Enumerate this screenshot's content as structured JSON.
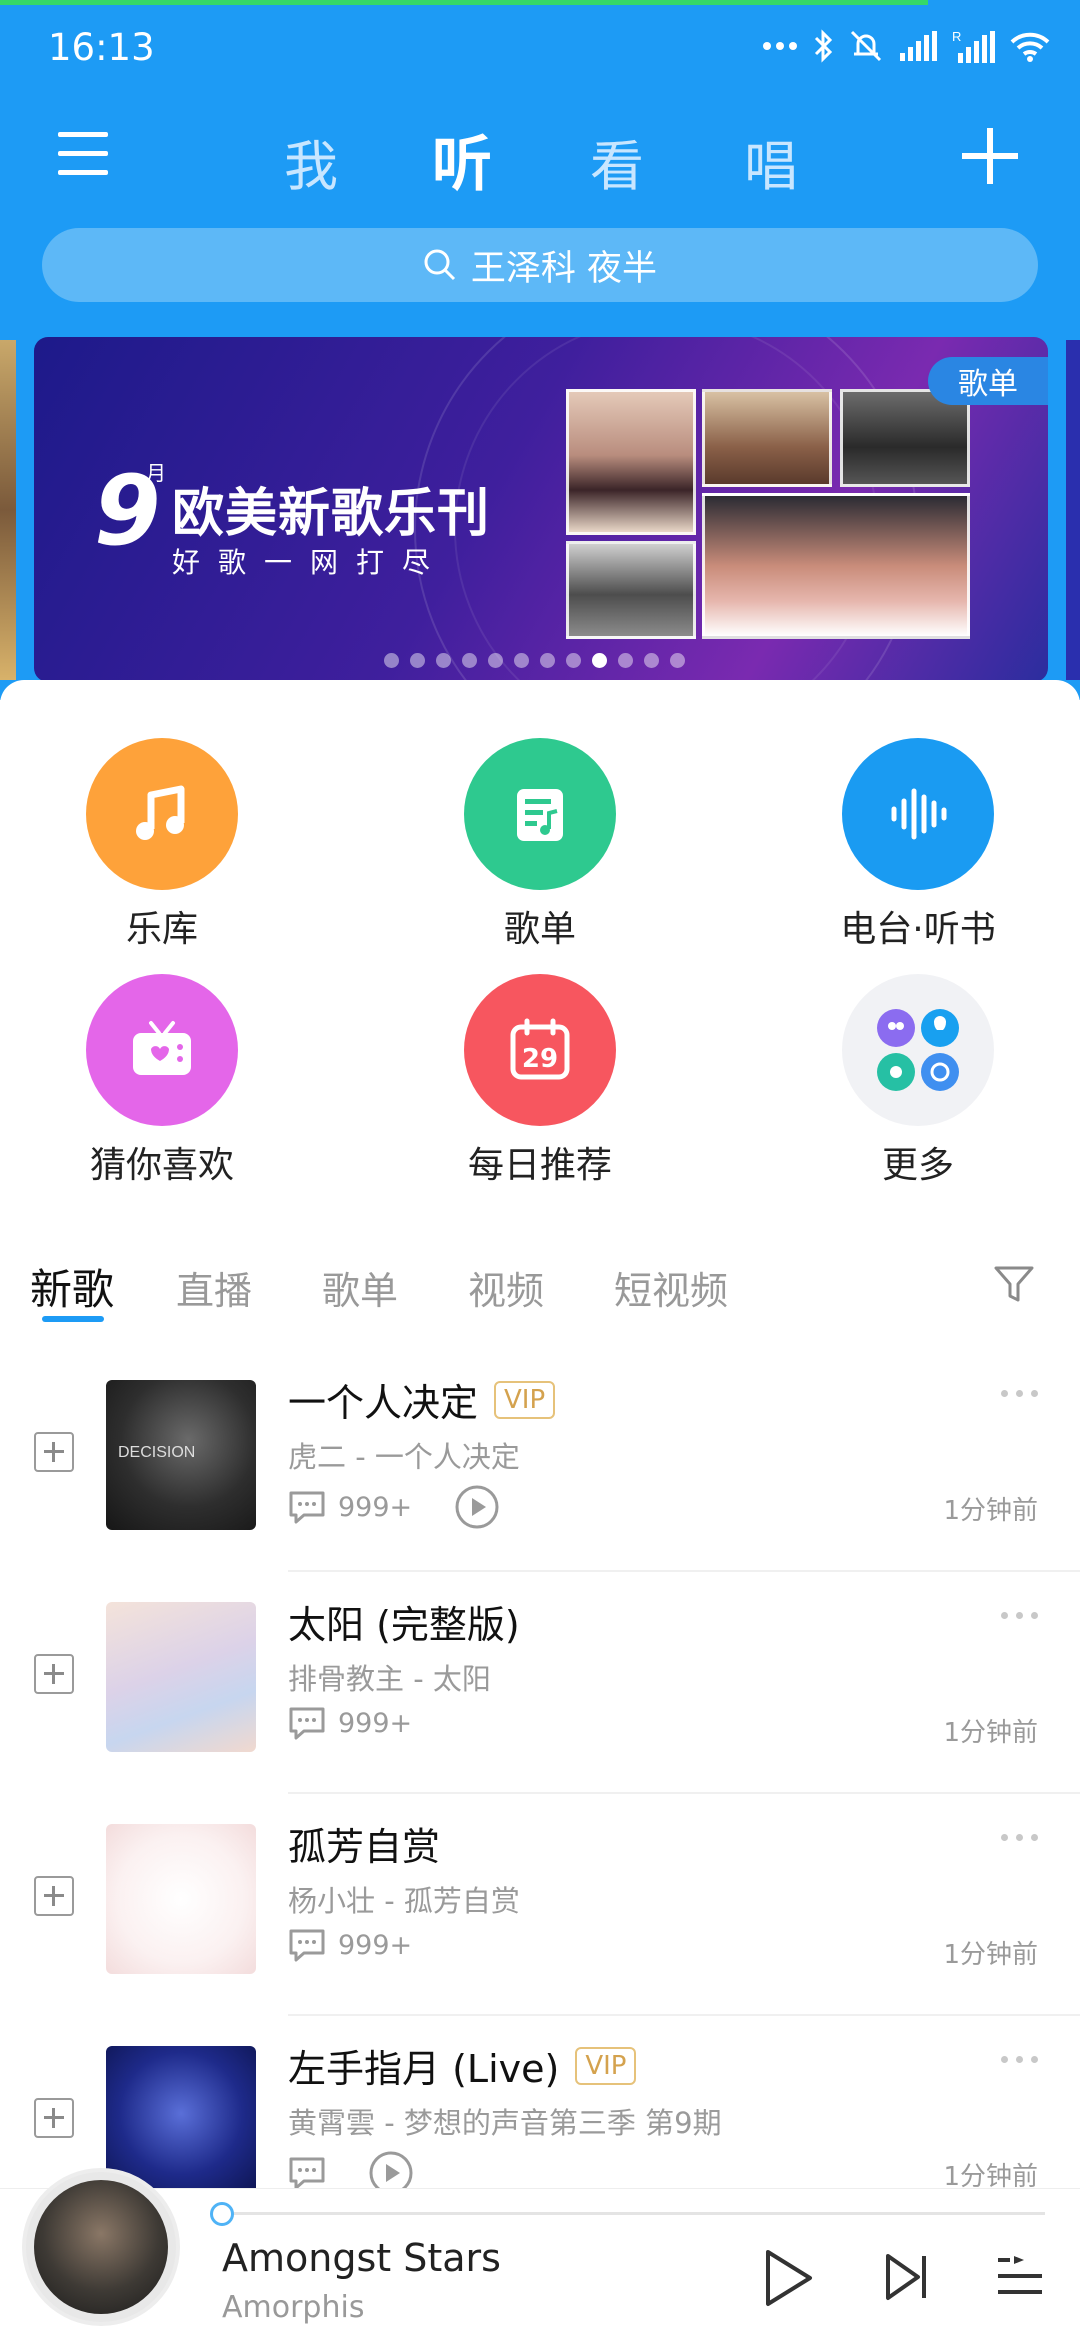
{
  "status_bar": {
    "time": "16:13"
  },
  "header": {
    "tabs": [
      {
        "label": "我",
        "active": false
      },
      {
        "label": "听",
        "active": true
      },
      {
        "label": "看",
        "active": false
      },
      {
        "label": "唱",
        "active": false
      }
    ]
  },
  "search": {
    "placeholder": "王泽科 夜半"
  },
  "banner": {
    "tag": "歌单",
    "number": "9",
    "month": "月",
    "title": "欧美新歌乐刊",
    "subtitle": "好歌一网打尽",
    "dot_count": 12,
    "active_dot": 8
  },
  "quick_entries": [
    {
      "label": "乐库",
      "icon": "music-note-icon",
      "color": "#fea23a"
    },
    {
      "label": "歌单",
      "icon": "playlist-icon",
      "color": "#2ec98f"
    },
    {
      "label": "电台·听书",
      "icon": "sound-wave-icon",
      "color": "#1a9bf2"
    },
    {
      "label": "猜你喜欢",
      "icon": "radio-heart-icon",
      "color": "#e466e9"
    },
    {
      "label": "每日推荐",
      "icon": "calendar-icon",
      "color": "#f7565f",
      "calendar_day": "29"
    },
    {
      "label": "更多",
      "icon": "more-apps-icon",
      "color": "#f1f2f5"
    }
  ],
  "content_tabs": [
    {
      "label": "新歌",
      "active": true
    },
    {
      "label": "直播",
      "active": false
    },
    {
      "label": "歌单",
      "active": false
    },
    {
      "label": "视频",
      "active": false
    },
    {
      "label": "短视频",
      "active": false
    }
  ],
  "songs": [
    {
      "title": "一个人决定",
      "vip": "VIP",
      "subtitle": "虎二 - 一个人决定",
      "comments": "999+",
      "has_mv": true,
      "time": "1分钟前"
    },
    {
      "title": "太阳 (完整版)",
      "vip": "",
      "subtitle": "排骨教主 - 太阳",
      "comments": "999+",
      "has_mv": false,
      "time": "1分钟前"
    },
    {
      "title": "孤芳自赏",
      "vip": "",
      "subtitle": "杨小壮 - 孤芳自赏",
      "comments": "999+",
      "has_mv": false,
      "time": "1分钟前"
    },
    {
      "title": "左手指月 (Live)",
      "vip": "VIP",
      "subtitle": "黄霄雲 - 梦想的声音第三季 第9期",
      "comments": "",
      "has_mv": true,
      "time": "1分钟前"
    }
  ],
  "player": {
    "title": "Amongst Stars",
    "artist": "Amorphis",
    "progress": 0.0
  },
  "colors": {
    "brand_blue": "#1d9bf5",
    "vip_gold": "#d4a24e"
  }
}
